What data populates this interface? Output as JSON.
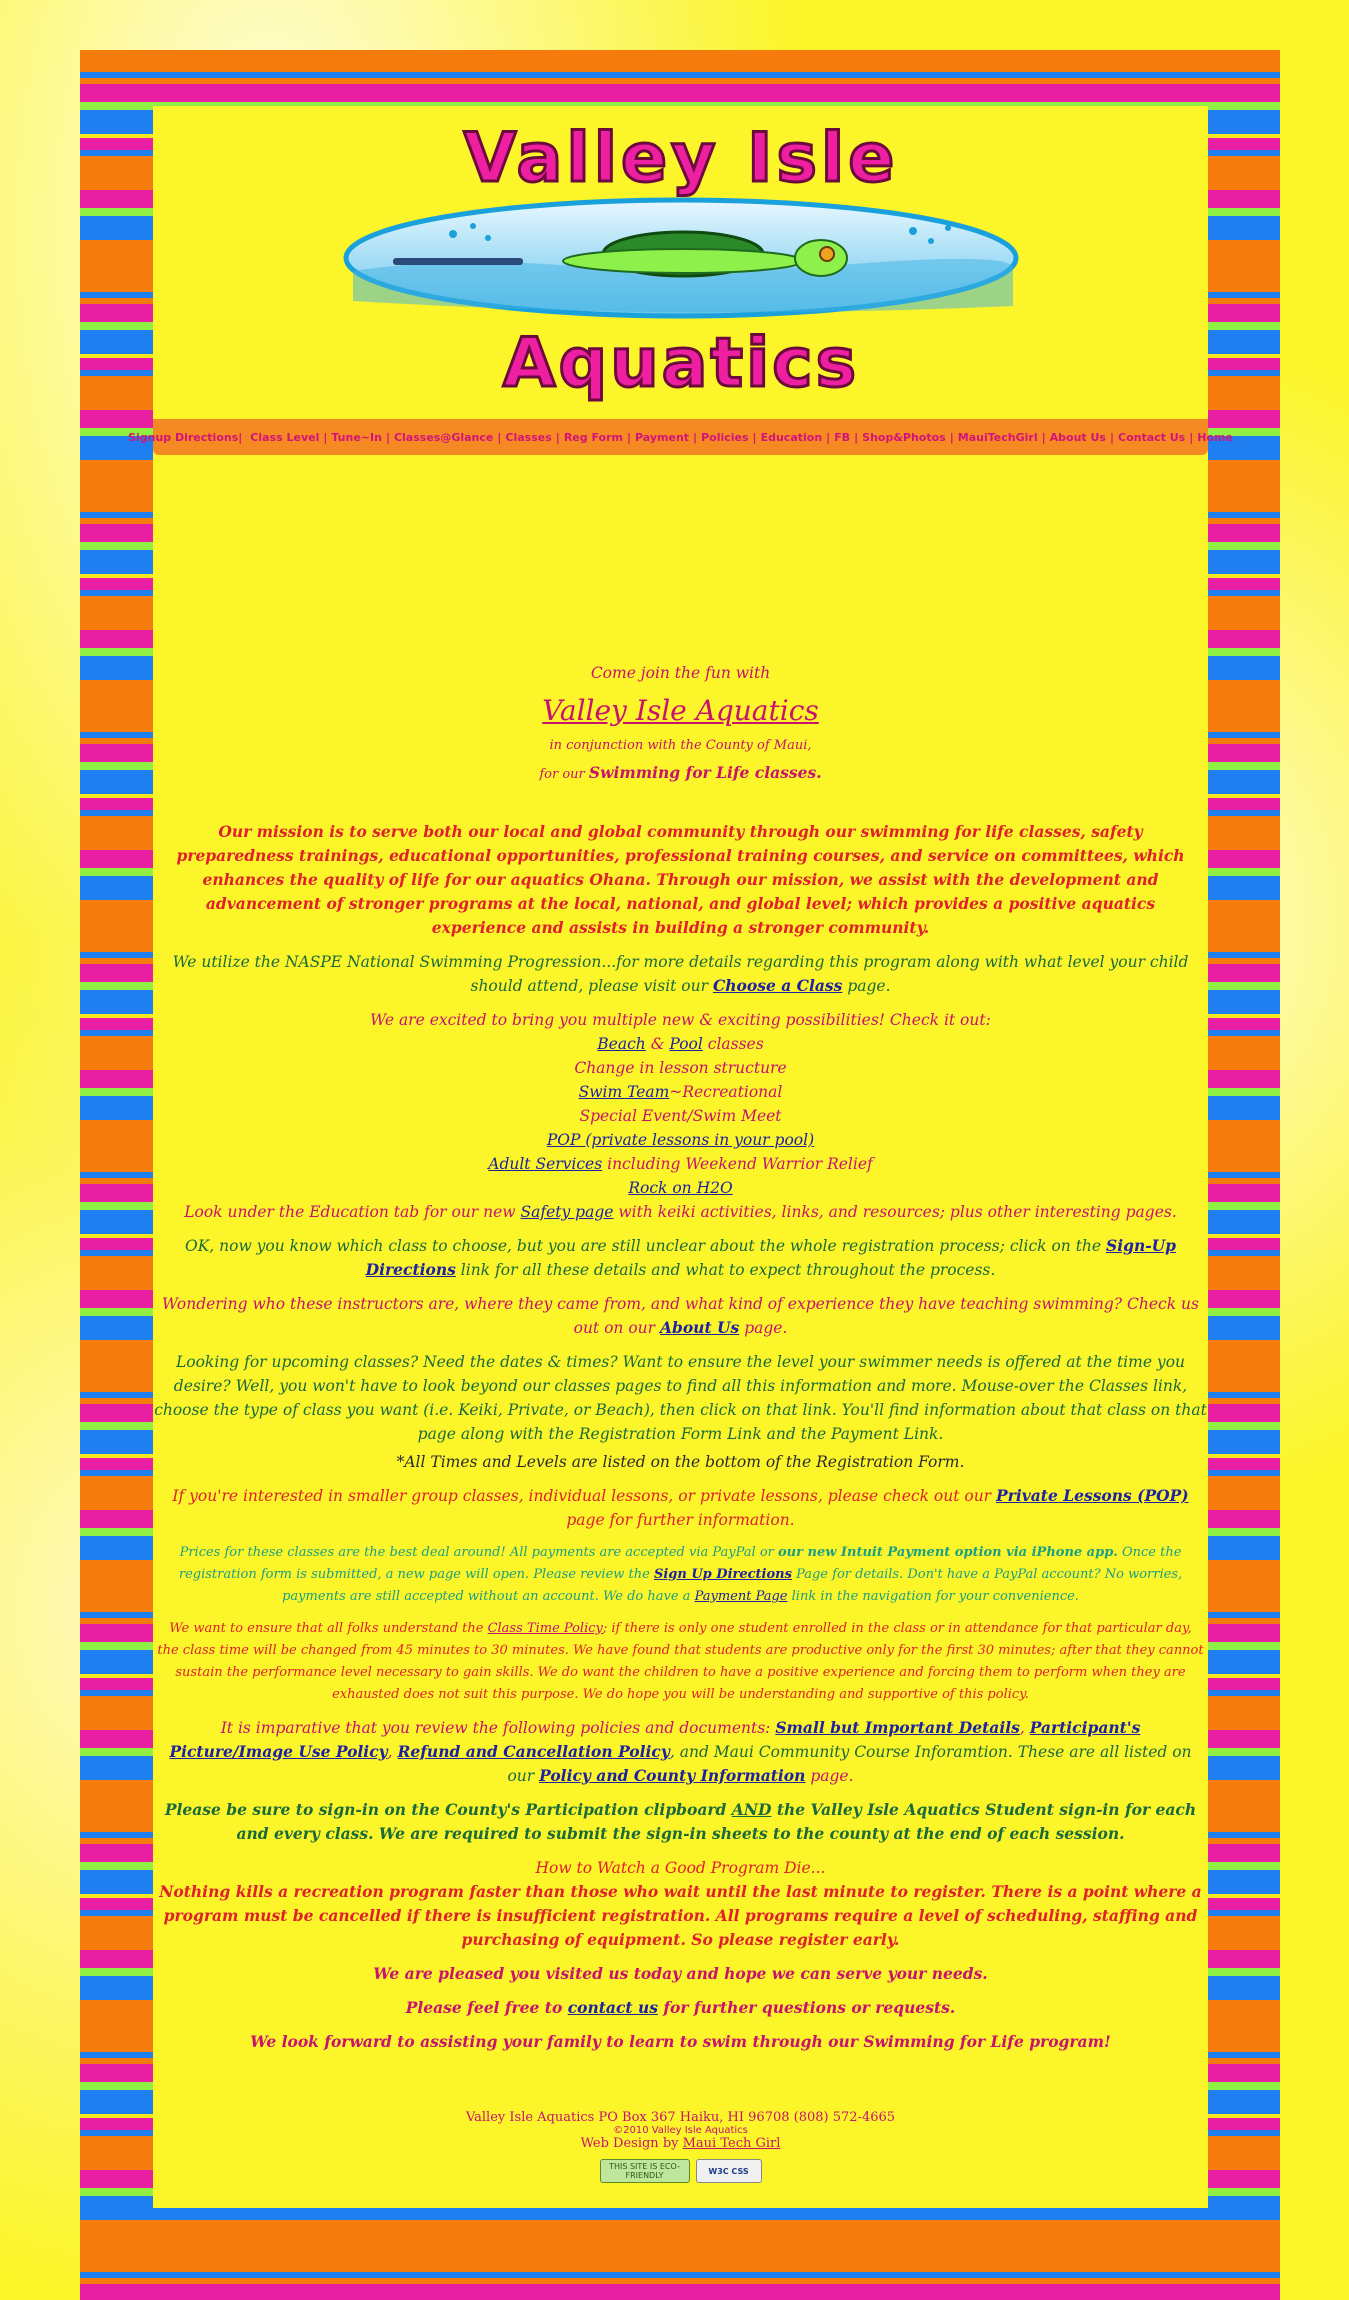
{
  "header": {
    "logo_line1": "Valley Isle",
    "logo_line2": "Aquatics"
  },
  "nav": {
    "items": [
      "Signup Directions|",
      "Class Level",
      "Tune~In",
      "Classes@Glance",
      "Classes",
      "Reg Form",
      "Payment",
      "Policies",
      "Education",
      "FB",
      "Shop&Photos",
      "MauiTechGirl",
      "About Us",
      "Contact Us",
      "Home"
    ]
  },
  "intro": {
    "come_join": "Come join the fun with",
    "title": "Valley Isle Aquatics",
    "conjunction": "in conjunction with the County of Maui,",
    "for_our": "for our ",
    "program": "Swimming for Life classes."
  },
  "mission": "Our mission is to serve both our local and global community through our swimming for life classes, safety preparedness trainings, educational opportunities, professional training courses, and service on committees, which enhances the quality of life for our aquatics Ohana. Through our mission, we assist with the development and advancement of stronger programs at the local, national, and global level; which provides a positive aquatics experience and assists in building a stronger community.",
  "naspe": {
    "text": "We utilize the NASPE National Swimming Progression...for more details regarding this program along with what level your child should attend, please visit our ",
    "link": "Choose a Class",
    "after": " page."
  },
  "excited": {
    "heading": "We are excited to bring you multiple new & exciting possibilities! Check it out:",
    "beach": "Beach",
    "amp": " & ",
    "pool": "Pool",
    "classes": " classes",
    "change": "Change in lesson structure",
    "swim_team": "Swim Team",
    "recreational": "~Recreational",
    "special": "Special Event/Swim Meet",
    "pop": "POP (private lessons in your pool)",
    "adult": "Adult Services",
    "adult_after": " including Weekend Warrior Relief",
    "rock": "Rock on H2O",
    "edu_before": "Look under the Education tab for our new ",
    "safety": "Safety page",
    "edu_after": " with keiki activities, links, and resources; plus other interesting pages."
  },
  "signup": {
    "before": "OK, now you know which class to choose, but you are still unclear about the whole registration process; click on the ",
    "link": "Sign-Up Directions",
    "after": " link for all these details and what to expect throughout the process."
  },
  "about": {
    "before": "Wondering who these instructors are, where they came from, and what kind of experience they have teaching swimming? Check us out on our ",
    "link": "About Us",
    "after": " page."
  },
  "upcoming": {
    "text": "Looking for upcoming classes? Need the dates & times? Want to ensure the level your swimmer needs is offered at the time you desire? Well, you won't have to look beyond our classes pages to find all this information and more.  Mouse-over the Classes link, choose the type of class you want (i.e. Keiki, Private, or Beach), then click on that link.  You'll find information about that class on that page along with the Registration Form Link and the Payment Link.",
    "note": "*All Times and Levels are listed on the bottom of the Registration Form."
  },
  "private": {
    "before": "If you're interested in smaller group classes, individual lessons, or private lessons, please check out our ",
    "link": "Private Lessons (POP)",
    "after": " page for further information."
  },
  "prices": {
    "t1": "Prices for these classes are the best deal around! All payments are accepted via PayPal or ",
    "bold": "our new Intuit Payment option via iPhone app.",
    "t2": " Once the registration form is submitted, a new page will open. Please review the ",
    "link1": "Sign Up Directions",
    "t3": " Page for details.  Don't have a PayPal account? No worries, payments are still accepted without an account.  We do have a ",
    "link2": "Payment Page",
    "t4": " link in the navigation for your convenience."
  },
  "time_policy": {
    "before": "We want to ensure that all folks understand the ",
    "link": "Class Time Policy",
    "after": "; if there is only one student enrolled in the class or in attendance for that particular day, the class time will be changed from 45 minutes to 30 minutes.  We have found that students are productive only for the first 30 minutes; after that they cannot sustain the performance level necessary to gain skills.  We do want the children to have a positive experience and forcing them to perform when they are exhausted does not suit this purpose.  We do hope you will be understanding and supportive of this policy."
  },
  "policies": {
    "t1": "It is imparative that you review the following policies and documents: ",
    "l1": "Small but Important Details",
    "c1": ", ",
    "l2": "Participant's Picture/Image Use Policy",
    "c2": ", ",
    "l3": "Refund and Cancellation Policy",
    "t2": ", and Maui Community Course Inforamtion. These are all listed on our ",
    "l4": "Policy and County Information",
    "t3": " page."
  },
  "signin": {
    "t1": "Please be sure to sign-in on the County's Participation clipboard ",
    "and": "AND",
    "t2": " the Valley Isle Aquatics Student sign-in for each and every class.  We are required to submit the sign-in sheets to the county at the end of each session."
  },
  "die": {
    "heading": "How to Watch a Good Program Die...",
    "text": "Nothing kills a recreation program faster than those who wait until the last minute to register. There is a point where a program must be cancelled if there is insufficient registration. All programs require a level of scheduling, staffing and purchasing of equipment. So please register early."
  },
  "closing": {
    "pleased": "We are pleased you visited us today and hope we can serve your needs.",
    "feel_before": "Please feel free to ",
    "contact": "contact us",
    "feel_after": " for further questions or requests.",
    "forward": "We look forward to assisting your family to learn to swim through our Swimming for Life program!"
  },
  "footer": {
    "address": "Valley Isle Aquatics PO Box 367 Haiku, HI 96708   (808) 572-4665",
    "copyright": "©2010 Valley Isle Aquatics",
    "design_by": "Web Design by ",
    "designer": "Maui Tech Girl",
    "badge1": "THIS SITE IS ECO-FRIENDLY",
    "badge2": "W3C CSS"
  },
  "colors": {
    "page_yellow": "#fbf52a",
    "orange": "#f47b0c",
    "blue": "#1f7ff0",
    "pink": "#e81fa3",
    "green": "#8ff043",
    "magenta_text": "#c8126e"
  }
}
